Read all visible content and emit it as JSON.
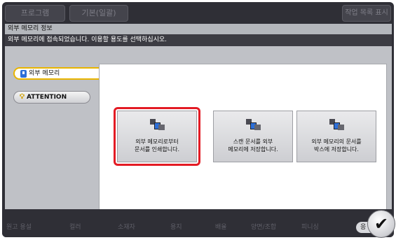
{
  "top_bar": {
    "tab_program": "프로그램",
    "tab_basic": "기본(일괄)",
    "job_list_label": "작업 목록 표시"
  },
  "dialog": {
    "title": "외부 메모리 정보",
    "message": "외부 메모리에 접속되었습니다. 이용할 용도를 선택하십시오."
  },
  "side_tabs": {
    "external_memory": "외부 메모리",
    "attention": "ATTENTION"
  },
  "options": [
    {
      "label": "외부 메모리로부터\n문서를 인쇄합니다."
    },
    {
      "label": "스캔 문서를 외부\n메모리에 저장합니다."
    },
    {
      "label": "외부 메모리의 문서를\n박스에 저장합니다."
    }
  ],
  "bottom_tabs": [
    "원고 용설",
    "컬러",
    "소재자",
    "용지",
    "배율",
    "양면/조합",
    "피니싱"
  ],
  "start_partial": "응",
  "icons": {
    "usb": "usb-memory-icon",
    "bulb": "lightbulb-icon",
    "confirm": "checkmark-icon"
  },
  "colors": {
    "highlight": "#e31b24",
    "selected_tab_border": "#e8b400",
    "accent_blue": "#2d6fd8"
  }
}
